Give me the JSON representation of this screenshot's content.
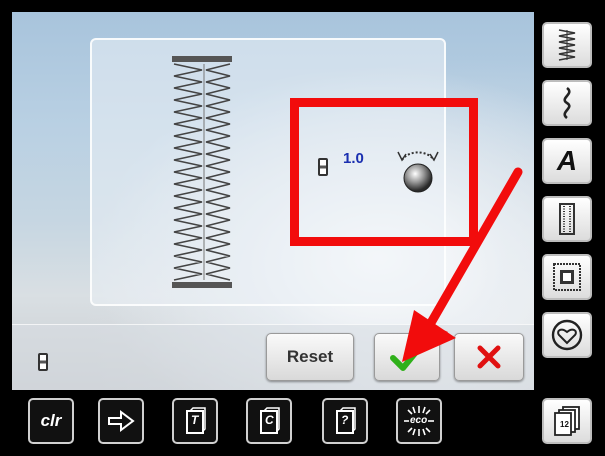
{
  "adjustment": {
    "value": "1.0",
    "icon": "presser-foot-pressure-knob-icon"
  },
  "actions": {
    "reset_label": "Reset",
    "confirm_icon": "checkmark-icon",
    "cancel_icon": "close-icon"
  },
  "sidebar": {
    "items": [
      {
        "icon": "straight-stitch-icon"
      },
      {
        "icon": "decorative-stitch-icon"
      },
      {
        "icon": "alphabet-icon",
        "label": "A"
      },
      {
        "icon": "buttonhole-icon"
      },
      {
        "icon": "quilt-stitch-icon"
      },
      {
        "icon": "personal-program-heart-icon"
      },
      {
        "icon": "memory-pages-icon",
        "label": "12"
      }
    ]
  },
  "toolbar": {
    "clr_label": "clr",
    "eco_label": "eco",
    "items": [
      {
        "icon": "clr-icon"
      },
      {
        "icon": "navigation-arrow-icon"
      },
      {
        "icon": "tutorial-T-icon",
        "label": "T"
      },
      {
        "icon": "creative-consultant-C-icon",
        "label": "C"
      },
      {
        "icon": "help-question-icon",
        "label": "?"
      },
      {
        "icon": "eco-icon"
      }
    ]
  },
  "colors": {
    "highlight": "#f20c0c",
    "confirm": "#2fb01a",
    "cancel": "#e01010",
    "value": "#1a2fb0"
  }
}
